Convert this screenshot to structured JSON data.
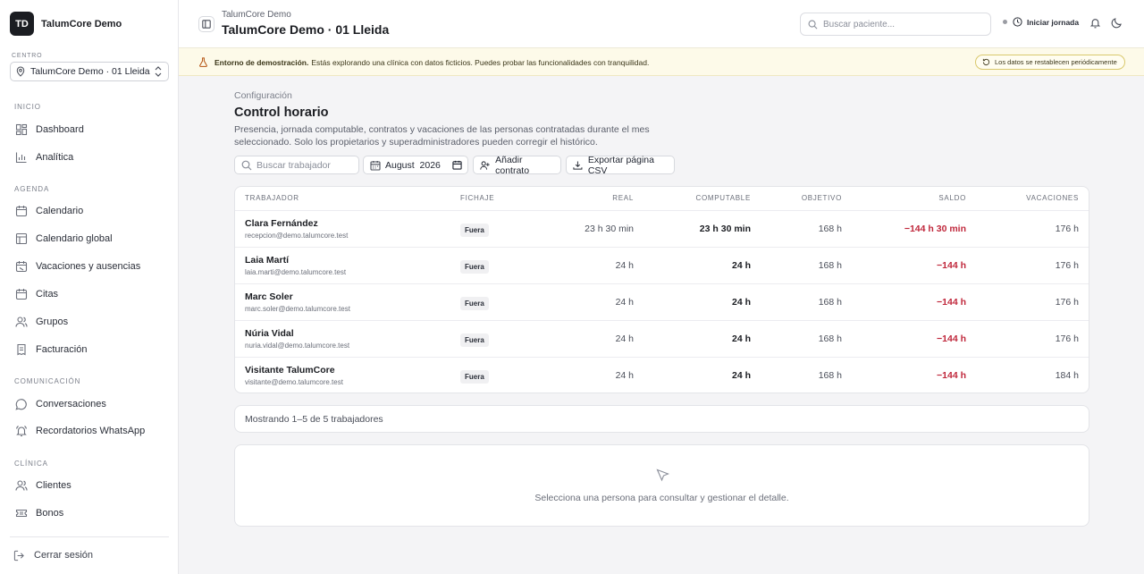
{
  "brand": {
    "initials": "TD",
    "name": "TalumCore Demo"
  },
  "center": {
    "label": "CENTRO",
    "value": "TalumCore Demo · 01 Lleida"
  },
  "nav": {
    "inicio_label": "INICIO",
    "agenda_label": "AGENDA",
    "comunicacion_label": "COMUNICACIÓN",
    "clinica_label": "CLÍNICA",
    "dashboard": "Dashboard",
    "analitica": "Analítica",
    "calendario": "Calendario",
    "calendario_global": "Calendario global",
    "vacaciones": "Vacaciones y ausencias",
    "citas": "Citas",
    "grupos": "Grupos",
    "facturacion": "Facturación",
    "conversaciones": "Conversaciones",
    "recordatorios": "Recordatorios WhatsApp",
    "clientes": "Clientes",
    "bonos": "Bonos",
    "logout": "Cerrar sesión"
  },
  "header": {
    "subtitle": "TalumCore Demo",
    "title": "TalumCore Demo · 01 Lleida",
    "search_placeholder": "Buscar paciente...",
    "shift_label": "Iniciar jornada"
  },
  "banner": {
    "strong": "Entorno de demostración.",
    "text": "Estás explorando una clínica con datos ficticios. Puedes probar las funcionalidades con tranquilidad.",
    "pill": "Los datos se restablecen periódicamente"
  },
  "page": {
    "breadcrumb": "Configuración",
    "title": "Control horario",
    "description": "Presencia, jornada computable, contratos y vacaciones de las personas contratadas durante el mes seleccionado. Solo los propietarios y superadministradores pueden corregir el histórico."
  },
  "toolbar": {
    "search_placeholder": "Buscar trabajador",
    "month": "August  2026",
    "add_contract": "Añadir contrato",
    "export_csv": "Exportar página CSV"
  },
  "table": {
    "headers": {
      "worker": "TRABAJADOR",
      "fichaje": "FICHAJE",
      "real": "REAL",
      "computable": "COMPUTABLE",
      "objetivo": "OBJETIVO",
      "saldo": "SALDO",
      "vacaciones": "VACACIONES"
    },
    "rows": [
      {
        "name": "Clara Fernández",
        "email": "recepcion@demo.talumcore.test",
        "fichaje": "Fuera",
        "real": "23 h 30 min",
        "computable": "23 h 30 min",
        "objetivo": "168 h",
        "saldo": "−144 h 30 min",
        "vacaciones": "176 h"
      },
      {
        "name": "Laia Martí",
        "email": "laia.marti@demo.talumcore.test",
        "fichaje": "Fuera",
        "real": "24 h",
        "computable": "24 h",
        "objetivo": "168 h",
        "saldo": "−144 h",
        "vacaciones": "176 h"
      },
      {
        "name": "Marc Soler",
        "email": "marc.soler@demo.talumcore.test",
        "fichaje": "Fuera",
        "real": "24 h",
        "computable": "24 h",
        "objetivo": "168 h",
        "saldo": "−144 h",
        "vacaciones": "176 h"
      },
      {
        "name": "Núria Vidal",
        "email": "nuria.vidal@demo.talumcore.test",
        "fichaje": "Fuera",
        "real": "24 h",
        "computable": "24 h",
        "objetivo": "168 h",
        "saldo": "−144 h",
        "vacaciones": "176 h"
      },
      {
        "name": "Visitante TalumCore",
        "email": "visitante@demo.talumcore.test",
        "fichaje": "Fuera",
        "real": "24 h",
        "computable": "24 h",
        "objetivo": "168 h",
        "saldo": "−144 h",
        "vacaciones": "184 h"
      }
    ]
  },
  "footer": {
    "count": "Mostrando 1–5 de 5 trabajadores",
    "detail_empty": "Selecciona una persona para consultar y gestionar el detalle."
  },
  "colors": {
    "negative": "#c0283c",
    "banner_bg": "#fdfae9",
    "brand_dark": "#1b1d22"
  }
}
